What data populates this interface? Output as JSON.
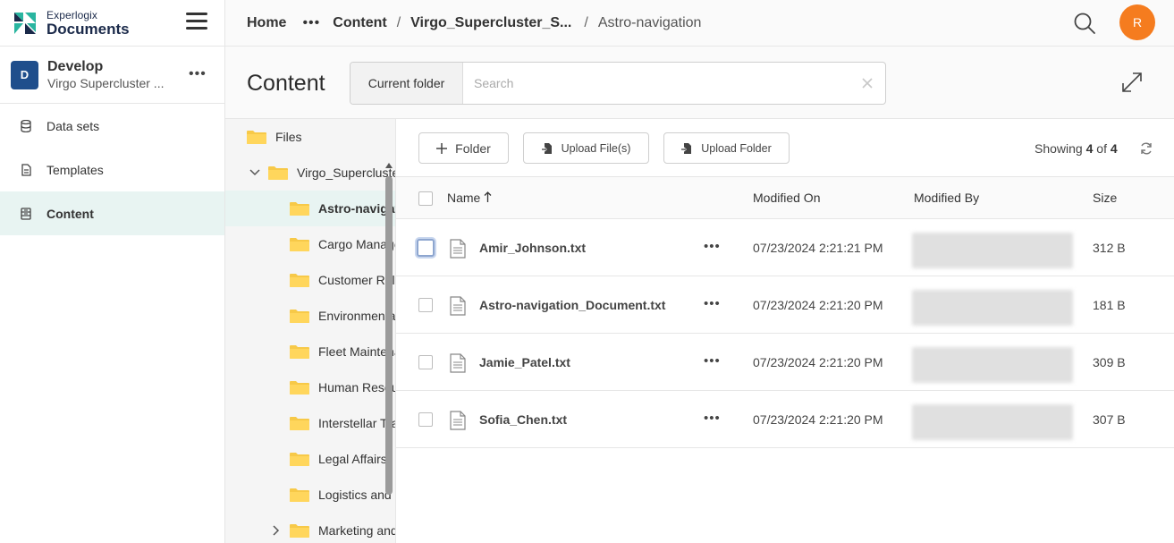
{
  "brand": {
    "line1": "Experlogix",
    "line2": "Documents",
    "colors": {
      "teal": "#29b5a0",
      "navy": "#1b2a4a"
    }
  },
  "project": {
    "badge": "D",
    "name": "Develop",
    "subtitle": "Virgo Supercluster ...",
    "more": "•••"
  },
  "nav": [
    {
      "label": "Data sets",
      "icon": "database-icon"
    },
    {
      "label": "Templates",
      "icon": "document-icon"
    },
    {
      "label": "Content",
      "icon": "archive-icon",
      "active": true
    }
  ],
  "breadcrumb": {
    "home": "Home",
    "ellipsis": "•••",
    "content": "Content",
    "sep": "/",
    "supercluster": "Virgo_Supercluster_S...",
    "current": "Astro-navigation"
  },
  "user": {
    "initial": "R",
    "color": "#f57c1f"
  },
  "header": {
    "title": "Content",
    "scope": "Current folder",
    "search_placeholder": "Search",
    "search_value": ""
  },
  "tree": {
    "root": "Files",
    "parent": "Virgo_Supercluster_Systems",
    "children": [
      {
        "label": "Astro-navigation",
        "selected": true
      },
      {
        "label": "Cargo Management"
      },
      {
        "label": "Customer Relations"
      },
      {
        "label": "Environmental Systems"
      },
      {
        "label": "Fleet Maintenance"
      },
      {
        "label": "Human Resources"
      },
      {
        "label": "Interstellar Trade"
      },
      {
        "label": "Legal Affairs"
      },
      {
        "label": "Logistics and Supply"
      },
      {
        "label": "Marketing and Sales",
        "collapsed": true
      }
    ]
  },
  "toolbar": {
    "folder": "Folder",
    "upload_files": "Upload File(s)",
    "upload_folder": "Upload Folder",
    "showing_prefix": "Showing",
    "showing_count": "4",
    "showing_of": "of",
    "showing_total": "4"
  },
  "table": {
    "columns": {
      "name": "Name",
      "modified_on": "Modified On",
      "modified_by": "Modified By",
      "size": "Size"
    },
    "sort": "ascending",
    "rows": [
      {
        "name": "Amir_Johnson.txt",
        "modified_on": "07/23/2024 2:21:21 PM",
        "size": "312 B"
      },
      {
        "name": "Astro-navigation_Document.txt",
        "modified_on": "07/23/2024 2:21:20 PM",
        "size": "181 B"
      },
      {
        "name": "Jamie_Patel.txt",
        "modified_on": "07/23/2024 2:21:20 PM",
        "size": "309 B"
      },
      {
        "name": "Sofia_Chen.txt",
        "modified_on": "07/23/2024 2:21:20 PM",
        "size": "307 B"
      }
    ],
    "row_more": "•••"
  }
}
